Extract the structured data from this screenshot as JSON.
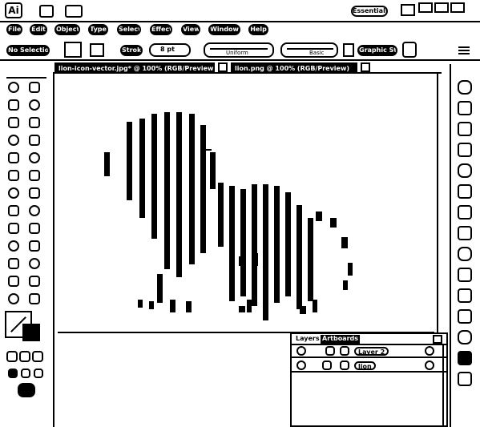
{
  "app": {
    "logo": "Ai",
    "workspace": "Essentials"
  },
  "menu": [
    "File",
    "Edit",
    "Object",
    "Type",
    "Select",
    "Effect",
    "View",
    "Window",
    "Help"
  ],
  "controls": {
    "selection": "No Selection",
    "stroke_label": "Stroke:",
    "stroke_weight": "8 pt",
    "profile": "Uniform",
    "brush": "Basic",
    "style_label": "Graphic Styles"
  },
  "tabs": [
    {
      "label": "lion-icon-vector.jpg* @ 100% (RGB/Preview)"
    },
    {
      "label": "lion.png @ 100% (RGB/Preview)"
    }
  ],
  "layers_panel": {
    "tabs": [
      "Layers",
      "Artboards"
    ],
    "rows": [
      {
        "name": "Layer 2"
      },
      {
        "name": "lion"
      }
    ]
  },
  "icons": {
    "tools": [
      "selection-icon",
      "direct-selection-icon",
      "magic-wand-icon",
      "lasso-icon",
      "pen-icon",
      "type-icon",
      "line-icon",
      "rectangle-icon",
      "paintbrush-icon",
      "pencil-icon",
      "blob-brush-icon",
      "eraser-icon",
      "rotate-icon",
      "scale-icon",
      "warp-icon",
      "free-transform-icon",
      "symbol-sprayer-icon",
      "column-graph-icon",
      "mesh-icon",
      "gradient-icon",
      "eyedropper-icon",
      "blend-icon",
      "live-paint-icon",
      "slice-icon",
      "hand-icon",
      "zoom-icon"
    ],
    "dock": [
      "color-icon",
      "color-guide-icon",
      "swatches-icon",
      "brushes-icon",
      "symbols-icon",
      "stroke-icon",
      "gradient-icon",
      "transparency-icon",
      "appearance-icon",
      "graphic-styles-icon",
      "transform-icon",
      "align-icon",
      "pathfinder-icon",
      "layers-icon",
      "artboards-icon"
    ]
  }
}
